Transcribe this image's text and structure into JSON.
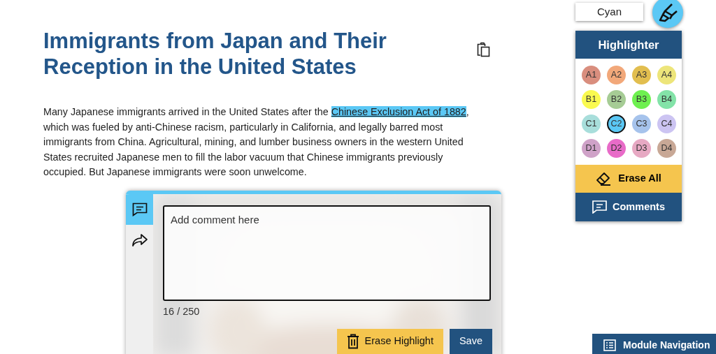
{
  "article": {
    "title": "Immigrants from Japan and Their Reception in the United States",
    "paragraph": [
      {
        "text": "Many Japanese immigrants arrived in the United States after the ",
        "highlighted": false
      },
      {
        "text": "Chinese Exclusion Act of 1882",
        "highlighted": true,
        "color": "#5bc8f5"
      },
      {
        "text": ", which was fueled by anti-Chinese racism, particularly in California, and legally barred most immigrants from China. Agricultural, mining, and lumber business owners in the western United States recruited Japanese men to fill the labor vacuum that Chinese immigrants previously occupied. But Japanese immigrants were soon unwelcome.",
        "highlighted": false
      }
    ]
  },
  "comment_panel": {
    "tabs": [
      {
        "kind": "comment",
        "selected": true
      },
      {
        "kind": "share",
        "selected": false
      }
    ],
    "comment": {
      "value": "Add comment here"
    },
    "counter": "16 / 250",
    "buttons": [
      {
        "kind": "erase",
        "label": "Erase Highlight"
      },
      {
        "kind": "save",
        "label": "Save"
      }
    ]
  },
  "highlighter": {
    "current_color_name": "Cyan",
    "title": "Highlighter",
    "swatches": [
      {
        "label": "A1",
        "color": "#d98e7e",
        "selected": false
      },
      {
        "label": "A2",
        "color": "#f2a87a",
        "selected": false
      },
      {
        "label": "A3",
        "color": "#e2be4f",
        "selected": false
      },
      {
        "label": "A4",
        "color": "#ede57a",
        "selected": false
      },
      {
        "label": "B1",
        "color": "#fafa50",
        "selected": false
      },
      {
        "label": "B2",
        "color": "#a6cc95",
        "selected": false
      },
      {
        "label": "B3",
        "color": "#6ef050",
        "selected": false
      },
      {
        "label": "B4",
        "color": "#83e3a8",
        "selected": false
      },
      {
        "label": "C1",
        "color": "#a8dedb",
        "selected": false
      },
      {
        "label": "C2",
        "color": "#5bc8f5",
        "selected": true
      },
      {
        "label": "C3",
        "color": "#a6c3ec",
        "selected": false
      },
      {
        "label": "C4",
        "color": "#ccc4f2",
        "selected": false
      },
      {
        "label": "D1",
        "color": "#cfa2c8",
        "selected": false
      },
      {
        "label": "D2",
        "color": "#e86bc8",
        "selected": false
      },
      {
        "label": "D3",
        "color": "#e7a9c3",
        "selected": false
      },
      {
        "label": "D4",
        "color": "#c8a896",
        "selected": false
      }
    ],
    "erase_all": "Erase All",
    "comments": "Comments"
  },
  "module_navigation": "Module Navigation"
}
